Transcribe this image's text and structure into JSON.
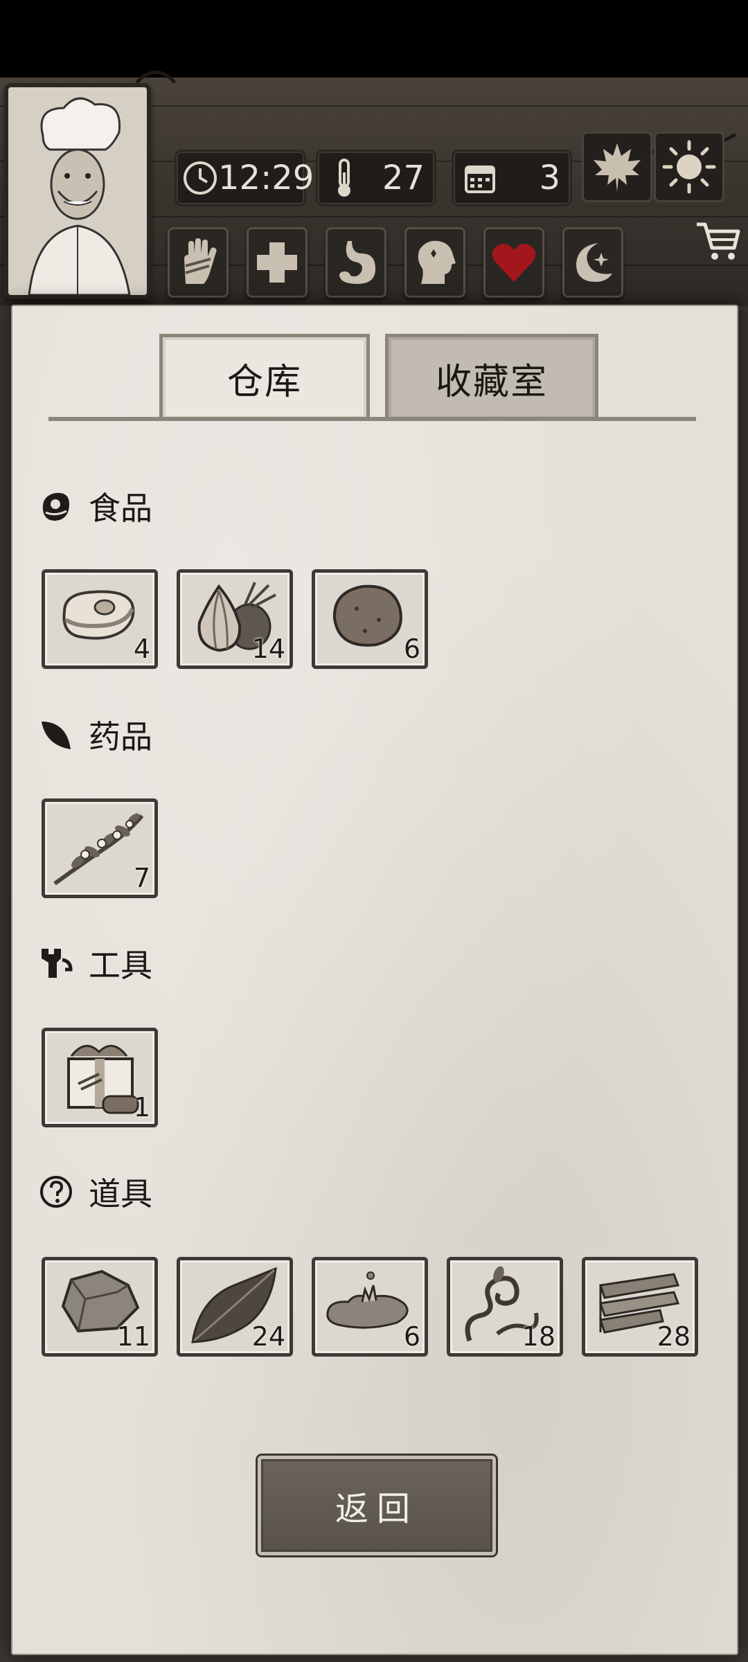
{
  "hud": {
    "time": "12:29",
    "temperature": "27",
    "day": "3"
  },
  "tabs": [
    {
      "label": "仓库",
      "active": true
    },
    {
      "label": "收藏室",
      "active": false
    }
  ],
  "categories": [
    {
      "name": "食品",
      "icon": "meat-category-icon",
      "items": [
        {
          "icon": "steak-icon",
          "count": "4"
        },
        {
          "icon": "onion-beet-icon",
          "count": "14"
        },
        {
          "icon": "potato-icon",
          "count": "6"
        }
      ]
    },
    {
      "name": "药品",
      "icon": "leaf-category-icon",
      "items": [
        {
          "icon": "herb-branch-icon",
          "count": "7"
        }
      ]
    },
    {
      "name": "工具",
      "icon": "wrench-category-icon",
      "items": [
        {
          "icon": "toolbox-icon",
          "count": "1"
        }
      ]
    },
    {
      "name": "道具",
      "icon": "question-category-icon",
      "items": [
        {
          "icon": "stone-icon",
          "count": "11"
        },
        {
          "icon": "leaf-icon",
          "count": "24"
        },
        {
          "icon": "water-puddle-icon",
          "count": "6"
        },
        {
          "icon": "vine-icon",
          "count": "18"
        },
        {
          "icon": "wood-planks-icon",
          "count": "28"
        }
      ]
    }
  ],
  "back_button": "返回",
  "colors": {
    "panel": "#e4e0d9",
    "wood": "#3b352f",
    "heart": "#a3161c",
    "button": "#5f5952"
  }
}
